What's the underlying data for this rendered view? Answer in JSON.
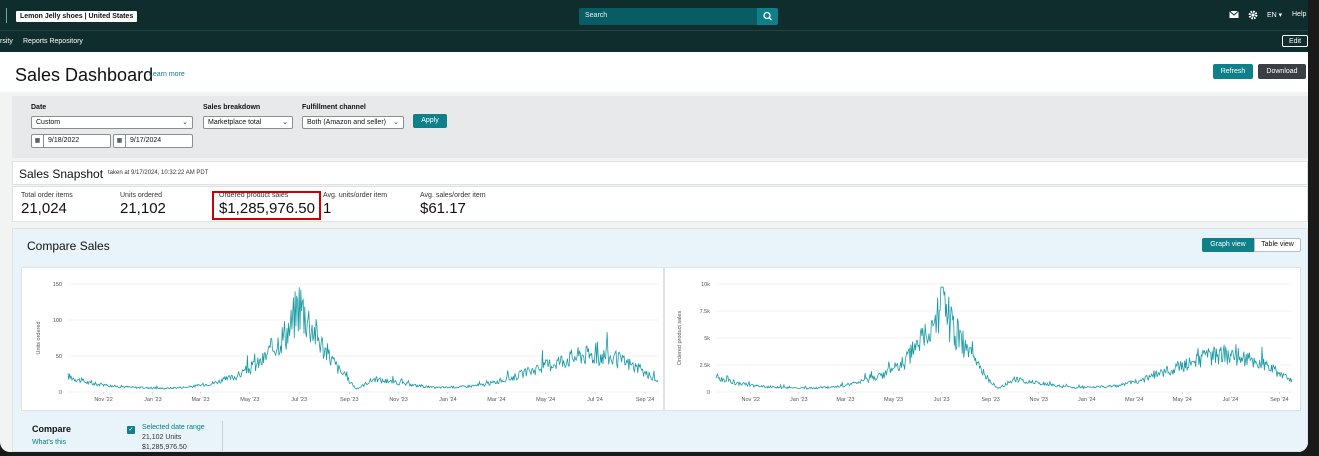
{
  "topbar": {
    "store_name": "Lemon Jelly shoes | United States",
    "search_placeholder": "Search",
    "language": "EN ▾",
    "help": "Help"
  },
  "subnav": {
    "items": [
      "rsity",
      "Reports Repository"
    ],
    "edit_label": "Edit"
  },
  "header": {
    "title": "Sales Dashboard",
    "learn_more": "Learn more",
    "refresh": "Refresh",
    "download": "Download"
  },
  "filters": {
    "date_label": "Date",
    "date_value": "Custom",
    "start_date": "9/18/2022",
    "end_date": "9/17/2024",
    "breakdown_label": "Sales breakdown",
    "breakdown_value": "Marketplace total",
    "fulfillment_label": "Fulfillment channel",
    "fulfillment_value": "Both (Amazon and seller)",
    "apply": "Apply"
  },
  "snapshot": {
    "title": "Sales Snapshot",
    "taken": "taken at 9/17/2024, 10:32:22 AM PDT",
    "metrics": [
      {
        "label": "Total order items",
        "value": "21,024"
      },
      {
        "label": "Units ordered",
        "value": "21,102"
      },
      {
        "label": "Ordered product sales",
        "value": "$1,285,976.50"
      },
      {
        "label": "Avg. units/order item",
        "value": "1"
      },
      {
        "label": "Avg. sales/order item",
        "value": "$61.17"
      }
    ]
  },
  "compare": {
    "title": "Compare Sales",
    "graph_view": "Graph view",
    "table_view": "Table view",
    "compare_label": "Compare",
    "whats_this": "What's this",
    "selected_range": "Selected date range",
    "selected_units": "21,102 Units",
    "selected_sales": "$1,285,976.50"
  },
  "colors": {
    "accent": "#0f7f88",
    "nav": "#0f2d2d",
    "line": "#1a9ba4",
    "highlight": "#d10000"
  },
  "chart_data": [
    {
      "type": "line",
      "title": "",
      "xlabel": "",
      "ylabel": "Units ordered",
      "ylim": [
        0,
        150
      ],
      "yticks": [
        0,
        50,
        100,
        150
      ],
      "ytick_labels": [
        "0",
        "50",
        "100",
        "150"
      ],
      "xtick_labels": [
        "Nov '22",
        "Jan '23",
        "Mar '23",
        "May '23",
        "Jul '23",
        "Sep '23",
        "Nov '23",
        "Jan '24",
        "Mar '24",
        "May '24",
        "Jul '24",
        "Sep '24"
      ],
      "series": [
        {
          "x": [
            "2022-09-18",
            "2022-10-15",
            "2022-11-15",
            "2022-12-15",
            "2023-01-15",
            "2023-02-15",
            "2023-03-15",
            "2023-04-15",
            "2023-05-15",
            "2023-06-01",
            "2023-06-20",
            "2023-07-01",
            "2023-07-15",
            "2023-08-01",
            "2023-08-20",
            "2023-09-10",
            "2023-10-01",
            "2023-11-15",
            "2023-12-15",
            "2024-01-15",
            "2024-02-15",
            "2024-03-15",
            "2024-04-15",
            "2024-05-15",
            "2024-06-15",
            "2024-07-15",
            "2024-08-15",
            "2024-09-17"
          ],
          "values": [
            22,
            12,
            8,
            6,
            5,
            7,
            12,
            22,
            42,
            65,
            90,
            125,
            95,
            60,
            30,
            4,
            18,
            10,
            6,
            7,
            10,
            18,
            30,
            42,
            52,
            50,
            38,
            15
          ]
        }
      ]
    },
    {
      "type": "line",
      "title": "",
      "xlabel": "",
      "ylabel": "Ordered product sales",
      "ylim": [
        0,
        10000
      ],
      "yticks": [
        0,
        2500,
        5000,
        7500,
        10000
      ],
      "ytick_labels": [
        "0",
        "2.5k",
        "5k",
        "7.5k",
        "10k"
      ],
      "xtick_labels": [
        "Nov '22",
        "Jan '23",
        "Mar '23",
        "May '23",
        "Jul '23",
        "Sep '23",
        "Nov '23",
        "Jan '24",
        "Mar '24",
        "May '24",
        "Jul '24",
        "Sep '24"
      ],
      "series": [
        {
          "x": [
            "2022-09-18",
            "2022-10-15",
            "2022-11-15",
            "2022-12-15",
            "2023-01-15",
            "2023-02-15",
            "2023-03-15",
            "2023-04-15",
            "2023-05-15",
            "2023-06-01",
            "2023-06-20",
            "2023-07-01",
            "2023-07-15",
            "2023-08-01",
            "2023-08-20",
            "2023-09-10",
            "2023-10-01",
            "2023-11-15",
            "2023-12-15",
            "2024-01-15",
            "2024-02-15",
            "2024-03-15",
            "2024-04-15",
            "2024-05-15",
            "2024-06-15",
            "2024-07-15",
            "2024-08-15",
            "2024-09-17"
          ],
          "values": [
            1400,
            800,
            500,
            400,
            350,
            450,
            800,
            1500,
            2800,
            4400,
            6000,
            8200,
            6200,
            3900,
            2000,
            300,
            1200,
            650,
            400,
            450,
            650,
            1200,
            2000,
            2800,
            3500,
            3300,
            2500,
            1000
          ]
        }
      ]
    }
  ]
}
